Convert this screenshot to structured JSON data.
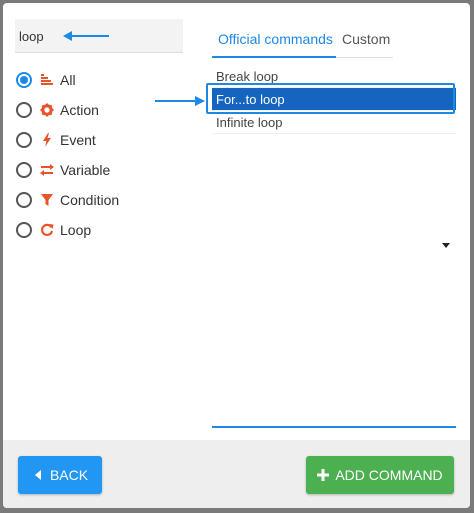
{
  "search": {
    "value": "loop",
    "placeholder": ""
  },
  "filters": [
    {
      "label": "All",
      "icon": "list-icon",
      "checked": true
    },
    {
      "label": "Action",
      "icon": "gear-icon",
      "checked": false
    },
    {
      "label": "Event",
      "icon": "bolt-icon",
      "checked": false
    },
    {
      "label": "Variable",
      "icon": "swap-icon",
      "checked": false
    },
    {
      "label": "Condition",
      "icon": "filter-icon",
      "checked": false
    },
    {
      "label": "Loop",
      "icon": "refresh-icon",
      "checked": false
    }
  ],
  "tabs": {
    "official": "Official commands",
    "custom": "Custom"
  },
  "commands": [
    {
      "label": "Break loop",
      "selected": false
    },
    {
      "label": "For...to loop",
      "selected": true
    },
    {
      "label": "Infinite loop",
      "selected": false
    }
  ],
  "buttons": {
    "back": "BACK",
    "add": "ADD COMMAND"
  },
  "colors": {
    "accent": "#1e88e5",
    "icon": "#e8542a",
    "add": "#4caf50",
    "back": "#2196f3",
    "selected": "#1565c0"
  }
}
